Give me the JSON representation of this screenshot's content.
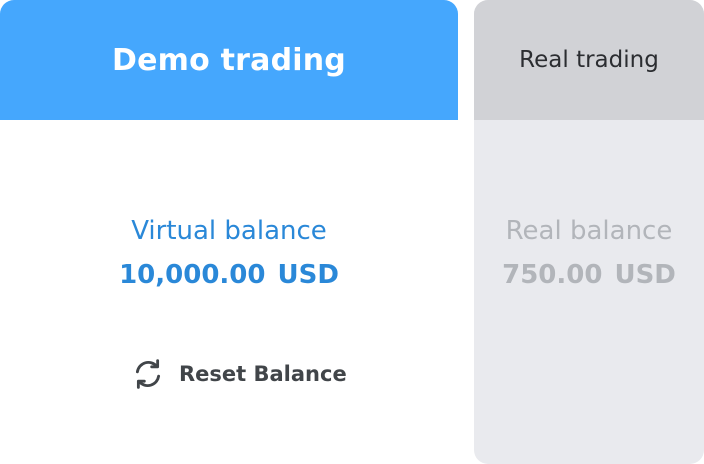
{
  "demo": {
    "tab_label": "Demo trading",
    "balance_label": "Virtual balance",
    "balance_amount": "10,000.00",
    "balance_currency": "USD",
    "reset_label": "Reset Balance",
    "reset_icon": "refresh-icon"
  },
  "real": {
    "tab_label": "Real trading",
    "balance_label": "Real balance",
    "balance_amount": "750.00",
    "balance_currency": "USD"
  },
  "colors": {
    "demo_header": "#45a7fd",
    "demo_text": "#2a88d8",
    "real_header": "#d1d2d6",
    "real_body": "#e9eaee",
    "real_text_muted": "#b2b5ba"
  }
}
